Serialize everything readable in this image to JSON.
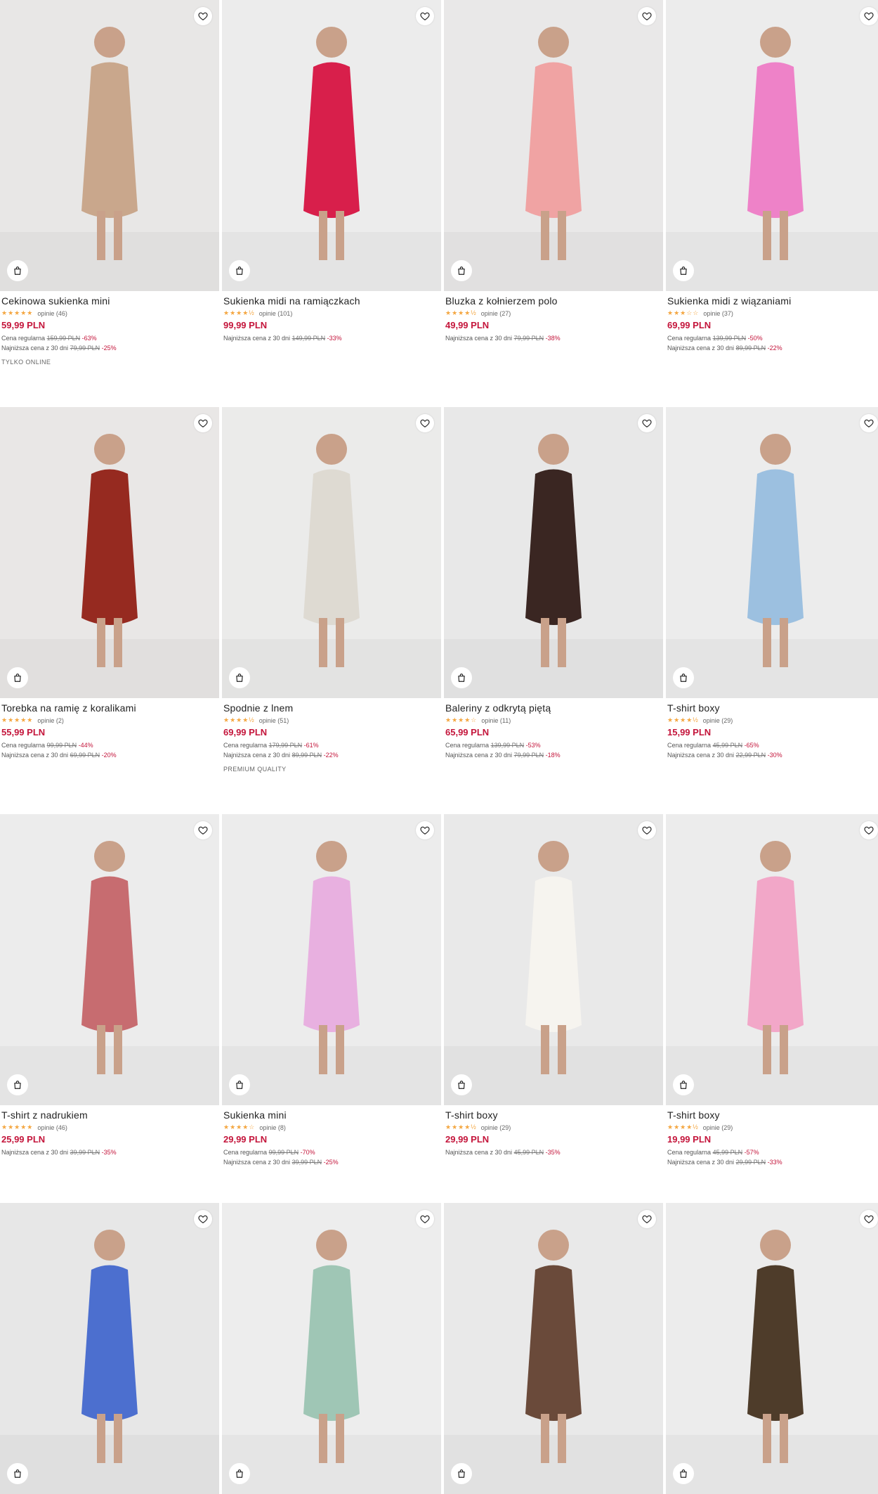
{
  "products": [
    {
      "name": "Cekinowa sukienka mini",
      "stars": "★★★★★",
      "reviews": "opinie (46)",
      "price": "59,99 PLN",
      "regular_label": "Cena regularna",
      "regular_price": "159,99 PLN",
      "regular_discount": "-63%",
      "lowest_label": "Najniższa cena z 30 dni",
      "lowest_price": "79,99 PLN",
      "lowest_discount": "-25%",
      "tag": "TYLKO ONLINE",
      "bg": "#e8e7e6",
      "accent": "#c9a78c"
    },
    {
      "name": "Sukienka midi na ramiączkach",
      "stars": "★★★★½",
      "reviews": "opinie (101)",
      "price": "99,99 PLN",
      "regular_label": "",
      "regular_price": "",
      "regular_discount": "",
      "lowest_label": "Najniższa cena z 30 dni",
      "lowest_price": "149,99 PLN",
      "lowest_discount": "-33%",
      "tag": "",
      "bg": "#ececec",
      "accent": "#d81f4b"
    },
    {
      "name": "Bluzka z kołnierzem polo",
      "stars": "★★★★½",
      "reviews": "opinie (27)",
      "price": "49,99 PLN",
      "regular_label": "",
      "regular_price": "",
      "regular_discount": "",
      "lowest_label": "Najniższa cena z 30 dni",
      "lowest_price": "79,99 PLN",
      "lowest_discount": "-38%",
      "tag": "",
      "bg": "#e9e8e8",
      "accent": "#f0a3a3"
    },
    {
      "name": "Sukienka midi z wiązaniami",
      "stars": "★★★☆☆",
      "reviews": "opinie (37)",
      "price": "69,99 PLN",
      "regular_label": "Cena regularna",
      "regular_price": "139,99 PLN",
      "regular_discount": "-50%",
      "lowest_label": "Najniższa cena z 30 dni",
      "lowest_price": "89,99 PLN",
      "lowest_discount": "-22%",
      "tag": "",
      "bg": "#ececec",
      "accent": "#ee82c8"
    },
    {
      "name": "Torebka na ramię z koralikami",
      "stars": "★★★★★",
      "reviews": "opinie (2)",
      "price": "55,99 PLN",
      "regular_label": "Cena regularna",
      "regular_price": "99,99 PLN",
      "regular_discount": "-44%",
      "lowest_label": "Najniższa cena z 30 dni",
      "lowest_price": "69,99 PLN",
      "lowest_discount": "-20%",
      "tag": "",
      "bg": "#e9e7e6",
      "accent": "#962a20"
    },
    {
      "name": "Spodnie z lnem",
      "stars": "★★★★½",
      "reviews": "opinie (51)",
      "price": "69,99 PLN",
      "regular_label": "Cena regularna",
      "regular_price": "179,99 PLN",
      "regular_discount": "-61%",
      "lowest_label": "Najniższa cena z 30 dni",
      "lowest_price": "89,99 PLN",
      "lowest_discount": "-22%",
      "tag": "PREMIUM QUALITY",
      "bg": "#ebebea",
      "accent": "#dedad2"
    },
    {
      "name": "Baleriny z odkrytą piętą",
      "stars": "★★★★☆",
      "reviews": "opinie (11)",
      "price": "65,99 PLN",
      "regular_label": "Cena regularna",
      "regular_price": "139,99 PLN",
      "regular_discount": "-53%",
      "lowest_label": "Najniższa cena z 30 dni",
      "lowest_price": "79,99 PLN",
      "lowest_discount": "-18%",
      "tag": "",
      "bg": "#e8e8e8",
      "accent": "#3a2622"
    },
    {
      "name": "T-shirt boxy",
      "stars": "★★★★½",
      "reviews": "opinie (29)",
      "price": "15,99 PLN",
      "regular_label": "Cena regularna",
      "regular_price": "45,99 PLN",
      "regular_discount": "-65%",
      "lowest_label": "Najniższa cena z 30 dni",
      "lowest_price": "22,99 PLN",
      "lowest_discount": "-30%",
      "tag": "",
      "bg": "#ececec",
      "accent": "#9cc0e0"
    },
    {
      "name": "T-shirt z nadrukiem",
      "stars": "★★★★★",
      "reviews": "opinie (46)",
      "price": "25,99 PLN",
      "regular_label": "",
      "regular_price": "",
      "regular_discount": "",
      "lowest_label": "Najniższa cena z 30 dni",
      "lowest_price": "39,99 PLN",
      "lowest_discount": "-35%",
      "tag": "",
      "bg": "#ececec",
      "accent": "#c76c70"
    },
    {
      "name": "Sukienka mini",
      "stars": "★★★★☆",
      "reviews": "opinie (8)",
      "price": "29,99 PLN",
      "regular_label": "Cena regularna",
      "regular_price": "99,99 PLN",
      "regular_discount": "-70%",
      "lowest_label": "Najniższa cena z 30 dni",
      "lowest_price": "39,99 PLN",
      "lowest_discount": "-25%",
      "tag": "",
      "bg": "#ececec",
      "accent": "#e8b0e0"
    },
    {
      "name": "T-shirt boxy",
      "stars": "★★★★½",
      "reviews": "opinie (29)",
      "price": "29,99 PLN",
      "regular_label": "",
      "regular_price": "",
      "regular_discount": "",
      "lowest_label": "Najniższa cena z 30 dni",
      "lowest_price": "45,99 PLN",
      "lowest_discount": "-35%",
      "tag": "",
      "bg": "#e9e9e9",
      "accent": "#f6f4ef"
    },
    {
      "name": "T-shirt boxy",
      "stars": "★★★★½",
      "reviews": "opinie (29)",
      "price": "19,99 PLN",
      "regular_label": "Cena regularna",
      "regular_price": "45,99 PLN",
      "regular_discount": "-57%",
      "lowest_label": "Najniższa cena z 30 dni",
      "lowest_price": "29,99 PLN",
      "lowest_discount": "-33%",
      "tag": "",
      "bg": "#ececec",
      "accent": "#f2a7c8"
    },
    {
      "name": "",
      "stars": "",
      "reviews": "",
      "price": "",
      "regular_label": "",
      "regular_price": "",
      "regular_discount": "",
      "lowest_label": "",
      "lowest_price": "",
      "lowest_discount": "",
      "tag": "",
      "bg": "#e7e7e7",
      "accent": "#4c6fcf"
    },
    {
      "name": "",
      "stars": "",
      "reviews": "",
      "price": "",
      "regular_label": "",
      "regular_price": "",
      "regular_discount": "",
      "lowest_label": "",
      "lowest_price": "",
      "lowest_discount": "",
      "tag": "",
      "bg": "#ededed",
      "accent": "#9fc6b5"
    },
    {
      "name": "",
      "stars": "",
      "reviews": "",
      "price": "",
      "regular_label": "",
      "regular_price": "",
      "regular_discount": "",
      "lowest_label": "",
      "lowest_price": "",
      "lowest_discount": "",
      "tag": "",
      "bg": "#e9e9e9",
      "accent": "#6a4a3a"
    },
    {
      "name": "",
      "stars": "",
      "reviews": "",
      "price": "",
      "regular_label": "",
      "regular_price": "",
      "regular_discount": "",
      "lowest_label": "",
      "lowest_price": "",
      "lowest_discount": "",
      "tag": "",
      "bg": "#ececec",
      "accent": "#4e3c2a"
    }
  ]
}
